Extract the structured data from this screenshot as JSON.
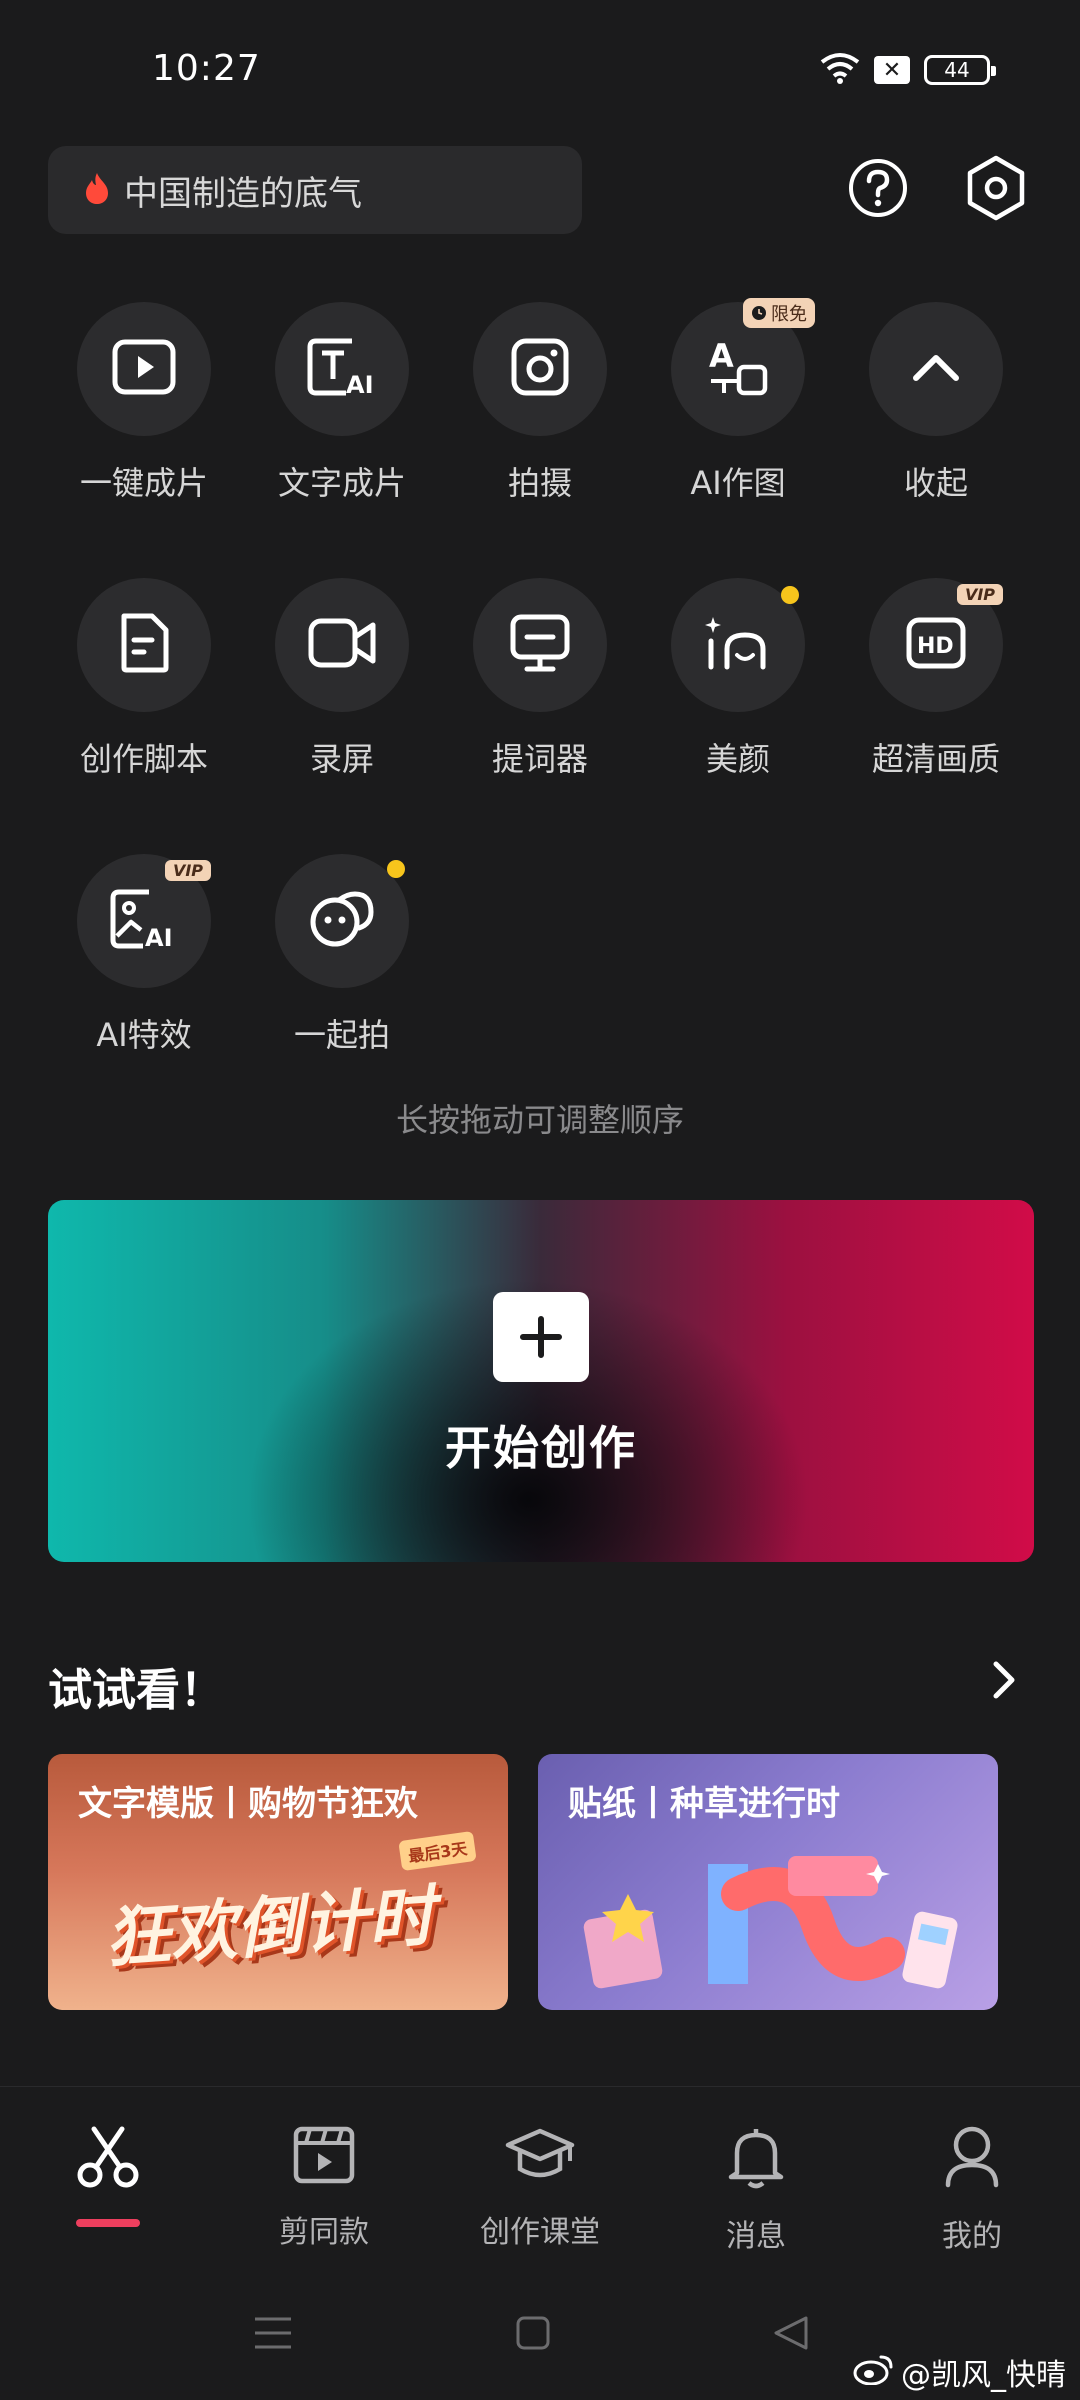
{
  "status_bar": {
    "time": "10:27",
    "battery": "44"
  },
  "search": {
    "text": "中国制造的底气"
  },
  "tools": [
    {
      "label": "一键成片",
      "icon": "play-box-icon"
    },
    {
      "label": "文字成片",
      "icon": "text-ai-icon"
    },
    {
      "label": "拍摄",
      "icon": "camera-icon"
    },
    {
      "label": "AI作图",
      "icon": "ai-draw-icon",
      "badge": "限免"
    },
    {
      "label": "收起",
      "icon": "chevron-up-icon"
    },
    {
      "label": "创作脚本",
      "icon": "script-doc-icon"
    },
    {
      "label": "录屏",
      "icon": "video-camera-icon"
    },
    {
      "label": "提词器",
      "icon": "teleprompter-icon"
    },
    {
      "label": "美颜",
      "icon": "beauty-icon"
    },
    {
      "label": "超清画质",
      "icon": "hd-icon",
      "badge": "VIP"
    },
    {
      "label": "AI特效",
      "icon": "ai-effect-icon",
      "badge": "VIP"
    },
    {
      "label": "一起拍",
      "icon": "shoot-together-icon"
    }
  ],
  "hint": "长按拖动可调整顺序",
  "create": {
    "label": "开始创作"
  },
  "try_section": {
    "title": "试试看！",
    "cards": [
      {
        "title": "文字模版丨购物节狂欢",
        "art_text": "狂欢倒计时",
        "tag": "最后3天"
      },
      {
        "title": "贴纸丨种草进行时"
      }
    ]
  },
  "bottom_nav": [
    {
      "label": "",
      "icon": "scissors-icon",
      "active": true
    },
    {
      "label": "剪同款",
      "icon": "template-film-icon"
    },
    {
      "label": "创作课堂",
      "icon": "graduation-cap-icon"
    },
    {
      "label": "消息",
      "icon": "bell-icon"
    },
    {
      "label": "我的",
      "icon": "profile-icon"
    }
  ],
  "watermark": "@凯风_快晴",
  "colors": {
    "background": "#1b1b1c",
    "accent": "#ee3f5e",
    "badge": "#f3d3b6",
    "dot": "#f7c51c"
  }
}
